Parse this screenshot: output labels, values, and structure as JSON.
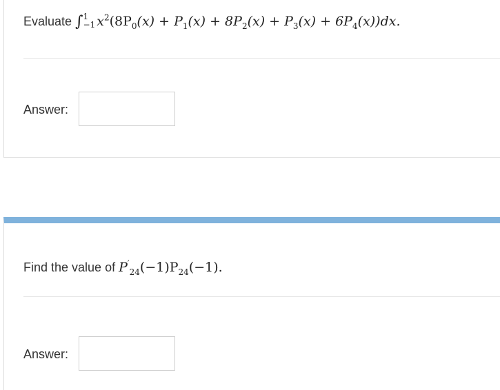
{
  "question1": {
    "prefix": "Evaluate",
    "integral_symbol": "∫",
    "upper_limit": "1",
    "lower_limit": "−1",
    "integrand": "x",
    "power": "2",
    "body_a": "(8P",
    "sub0": "0",
    "body_b": "(x) + P",
    "sub1": "1",
    "body_c": "(x) + 8P",
    "sub2": "2",
    "body_d": "(x) + P",
    "sub3": "3",
    "body_e": "(x) + 6P",
    "sub4": "4",
    "body_f": "(x))dx."
  },
  "answer1": {
    "label": "Answer:",
    "value": ""
  },
  "question2": {
    "prefix": "Find the value of",
    "p": "P",
    "prime": "′",
    "sub_a": "24",
    "body_a": "(−1)P",
    "sub_b": "24",
    "body_b": "(−1)."
  },
  "answer2": {
    "label": "Answer:",
    "value": ""
  },
  "colors": {
    "accent_bar": "#7fb2dc",
    "border": "#dcdcdc",
    "text": "#333333"
  }
}
